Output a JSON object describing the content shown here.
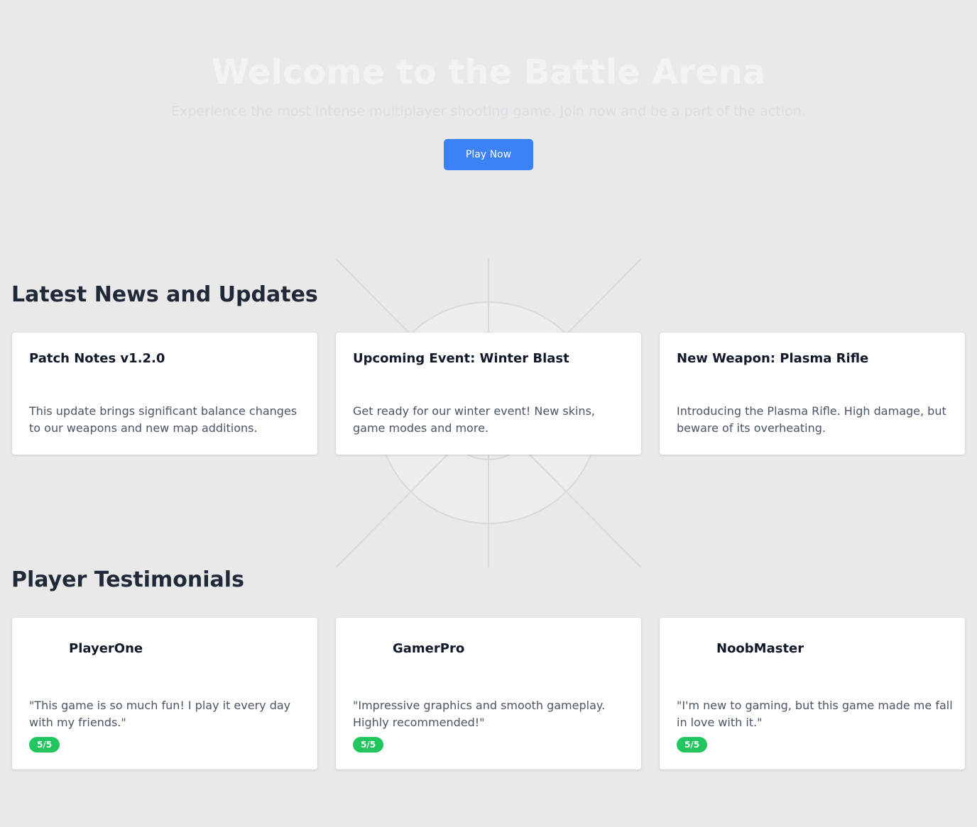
{
  "hero": {
    "title": "Welcome to the Battle Arena",
    "subtitle": "Experience the most intense multiplayer shooting game. Join now and be a part of the action.",
    "cta_label": "Play Now"
  },
  "news": {
    "heading": "Latest News and Updates",
    "items": [
      {
        "title": "Patch Notes v1.2.0",
        "text": "This update brings significant balance changes to our weapons and new map additions."
      },
      {
        "title": "Upcoming Event: Winter Blast",
        "text": "Get ready for our winter event! New skins, game modes and more."
      },
      {
        "title": "New Weapon: Plasma Rifle",
        "text": "Introducing the Plasma Rifle. High damage, but beware of its overheating."
      }
    ]
  },
  "testimonials": {
    "heading": "Player Testimonials",
    "items": [
      {
        "name": "PlayerOne",
        "quote": "\"This game is so much fun! I play it every day with my friends.\"",
        "rating": "5/5"
      },
      {
        "name": "GamerPro",
        "quote": "\"Impressive graphics and smooth gameplay. Highly recommended!\"",
        "rating": "5/5"
      },
      {
        "name": "NoobMaster",
        "quote": "\"I'm new to gaming, but this game made me fall in love with it.\"",
        "rating": "5/5"
      }
    ]
  },
  "colors": {
    "background": "#e9e9e9",
    "accent": "#3b82f6",
    "rating_badge": "#22c55e"
  },
  "icons": {
    "background_decoration": "crosshair-icon",
    "avatar": "avatar-icon"
  }
}
